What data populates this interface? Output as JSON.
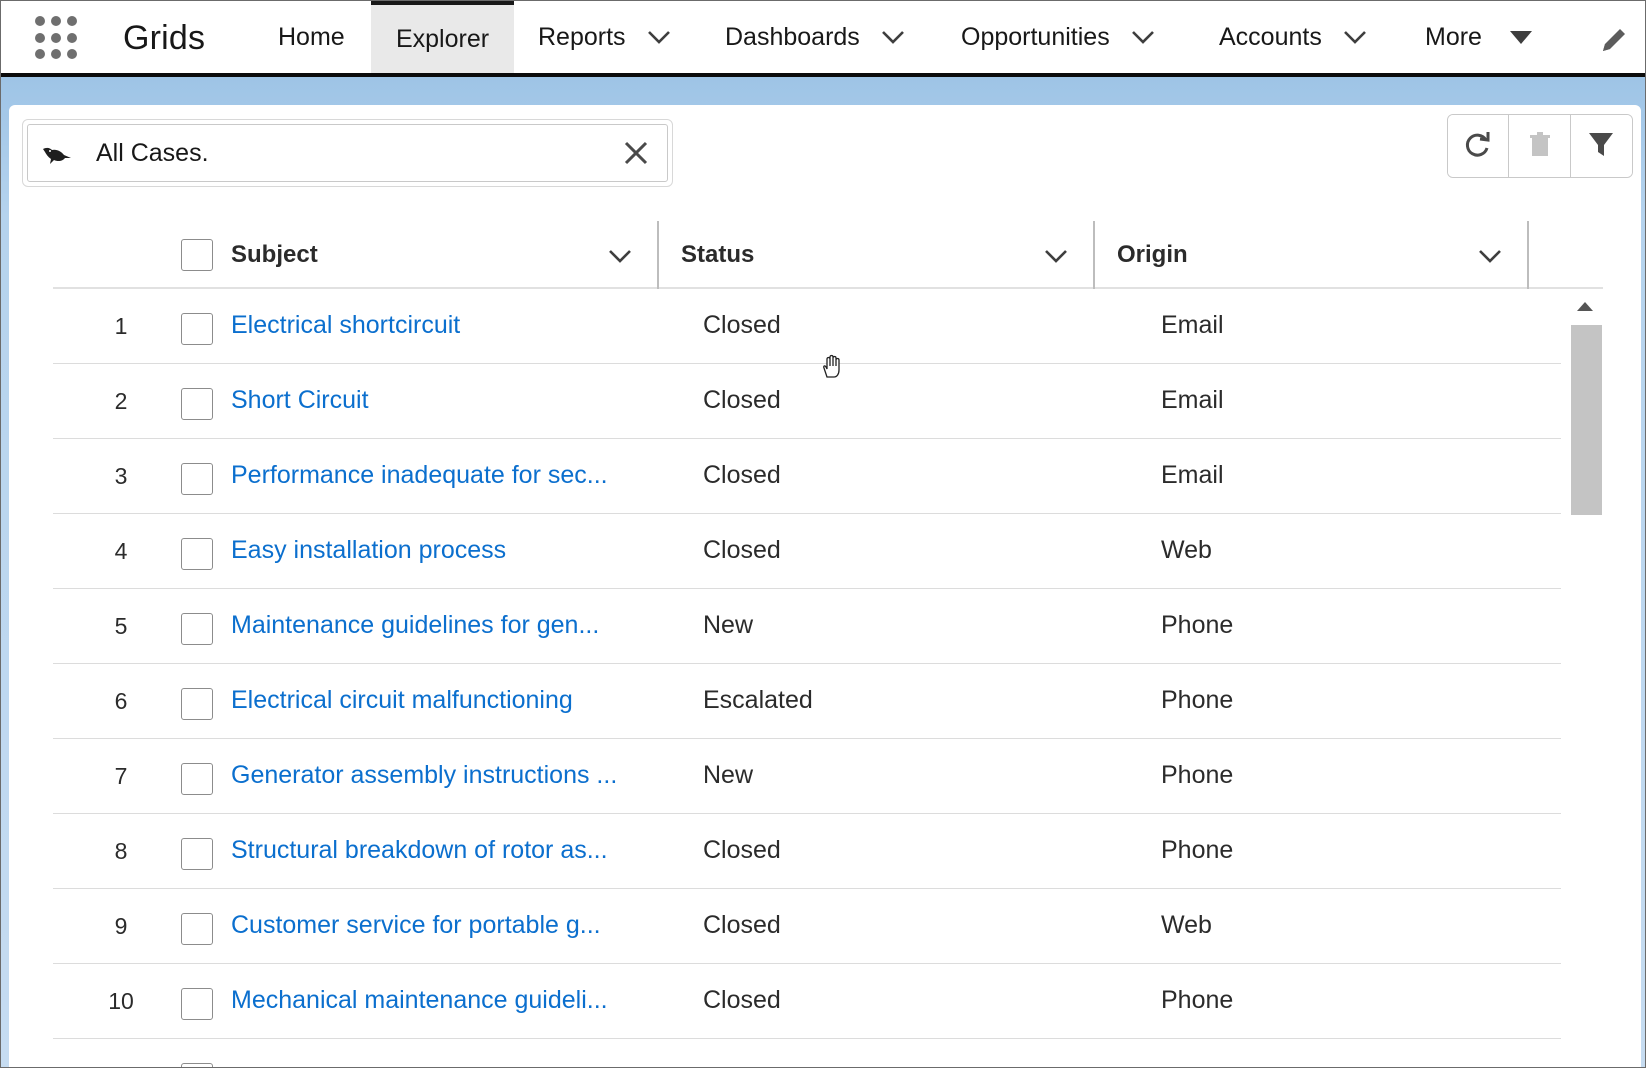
{
  "app": {
    "name": "Grids"
  },
  "nav": {
    "home": "Home",
    "explorer": "Explorer",
    "reports": "Reports",
    "dashboards": "Dashboards",
    "opportunities": "Opportunities",
    "accounts": "Accounts",
    "more": "More"
  },
  "search": {
    "value": "All Cases."
  },
  "columns": {
    "subject": "Subject",
    "status": "Status",
    "origin": "Origin"
  },
  "rows": [
    {
      "num": "1",
      "subject": "Electrical shortcircuit",
      "status": "Closed",
      "origin": "Email"
    },
    {
      "num": "2",
      "subject": "Short Circuit",
      "status": "Closed",
      "origin": "Email"
    },
    {
      "num": "3",
      "subject": "Performance inadequate for sec...",
      "status": "Closed",
      "origin": "Email"
    },
    {
      "num": "4",
      "subject": "Easy installation process",
      "status": "Closed",
      "origin": "Web"
    },
    {
      "num": "5",
      "subject": "Maintenance guidelines for gen...",
      "status": "New",
      "origin": "Phone"
    },
    {
      "num": "6",
      "subject": "Electrical circuit malfunctioning",
      "status": "Escalated",
      "origin": "Phone"
    },
    {
      "num": "7",
      "subject": "Generator assembly instructions ...",
      "status": "New",
      "origin": "Phone"
    },
    {
      "num": "8",
      "subject": "Structural breakdown of rotor as...",
      "status": "Closed",
      "origin": "Phone"
    },
    {
      "num": "9",
      "subject": "Customer service for portable g...",
      "status": "Closed",
      "origin": "Web"
    },
    {
      "num": "10",
      "subject": "Mechanical maintenance guideli...",
      "status": "Closed",
      "origin": "Phone"
    },
    {
      "num": "",
      "subject": "",
      "status": "",
      "origin": ""
    }
  ],
  "icons": {
    "app_launcher": "app-launcher-icon",
    "edit": "pencil-icon",
    "search_prefix": "bird-icon",
    "clear": "close-icon",
    "refresh": "refresh-icon",
    "delete": "trash-icon",
    "filter": "filter-icon",
    "sort": "chevron-down-icon"
  },
  "colors": {
    "link": "#0b6fce",
    "active_tab": "#e9e9e9",
    "background_band": "#b5d3ee"
  }
}
